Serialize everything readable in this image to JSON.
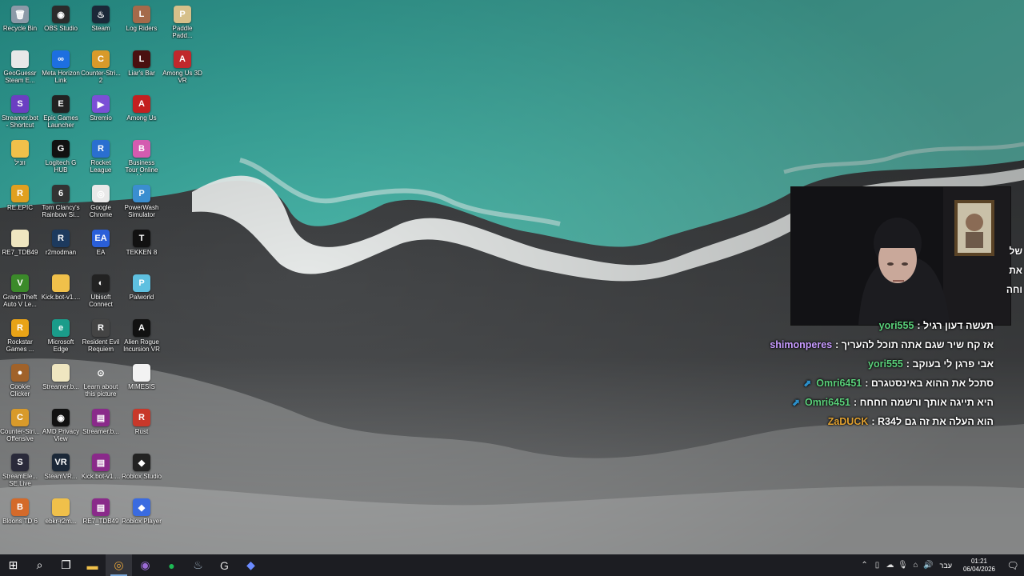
{
  "desktop": {
    "icons": [
      {
        "label": "Recycle Bin",
        "icon": "recycle-bin-icon",
        "bg": "#8c9aa8",
        "glyph": "🗑"
      },
      {
        "label": "OBS Studio",
        "icon": "obs-icon",
        "bg": "#2b2b2b",
        "glyph": "◉"
      },
      {
        "label": "Steam",
        "icon": "steam-icon",
        "bg": "#1b2838",
        "glyph": "♨"
      },
      {
        "label": "Log Riders",
        "icon": "log-riders-icon",
        "bg": "#a56a4a",
        "glyph": "L"
      },
      {
        "label": "Paddle Padd...",
        "icon": "paddle-icon",
        "bg": "#d6c08a",
        "glyph": "P"
      },
      {
        "label": "GeoGuessr Steam E...",
        "icon": "file-icon",
        "bg": "#e8e8e8",
        "glyph": ""
      },
      {
        "label": "Meta Horizon Link",
        "icon": "meta-icon",
        "bg": "#1d6fe0",
        "glyph": "∞"
      },
      {
        "label": "Counter-Stri... 2",
        "icon": "cs2-icon",
        "bg": "#d89a2a",
        "glyph": "C"
      },
      {
        "label": "Liar's Bar",
        "icon": "liars-bar-icon",
        "bg": "#4a1010",
        "glyph": "L"
      },
      {
        "label": "Among Us 3D VR",
        "icon": "among-us-vr-icon",
        "bg": "#c0282c",
        "glyph": "A"
      },
      {
        "label": "Streamer.bot - Shortcut",
        "icon": "streamerbot-icon",
        "bg": "#6b3fc2",
        "glyph": "S"
      },
      {
        "label": "Epic Games Launcher",
        "icon": "epic-icon",
        "bg": "#222",
        "glyph": "E"
      },
      {
        "label": "Stremio",
        "icon": "stremio-icon",
        "bg": "#7b4fd6",
        "glyph": "▶"
      },
      {
        "label": "Among Us",
        "icon": "among-us-icon",
        "bg": "#c32020",
        "glyph": "A"
      },
      {
        "label": "",
        "icon": "empty-slot",
        "bg": "transparent",
        "glyph": ""
      },
      {
        "label": "ווניל",
        "icon": "folder-icon",
        "bg": "#f0c04a",
        "glyph": ""
      },
      {
        "label": "Logitech G HUB",
        "icon": "logitech-icon",
        "bg": "#111",
        "glyph": "G"
      },
      {
        "label": "Rocket League",
        "icon": "rocket-league-icon",
        "bg": "#2a6fd0",
        "glyph": "R"
      },
      {
        "label": "Business Tour Online M...",
        "icon": "business-tour-icon",
        "bg": "#d45bb0",
        "glyph": "B"
      },
      {
        "label": "",
        "icon": "empty-slot",
        "bg": "transparent",
        "glyph": ""
      },
      {
        "label": "RE.EPIC",
        "icon": "re-epic-icon",
        "bg": "#e0a020",
        "glyph": "R"
      },
      {
        "label": "Tom Clancy's Rainbow Si...",
        "icon": "rainbow-six-icon",
        "bg": "#333",
        "glyph": "6"
      },
      {
        "label": "Google Chrome",
        "icon": "chrome-icon",
        "bg": "#e9e9e9",
        "glyph": "◎"
      },
      {
        "label": "PowerWash Simulator",
        "icon": "powerwash-icon",
        "bg": "#3a8ed0",
        "glyph": "P"
      },
      {
        "label": "",
        "icon": "empty-slot",
        "bg": "transparent",
        "glyph": ""
      },
      {
        "label": "RE7_TDB49",
        "icon": "file-icon",
        "bg": "#efe6c0",
        "glyph": ""
      },
      {
        "label": "r2modman",
        "icon": "r2modman-icon",
        "bg": "#1d3a5e",
        "glyph": "R"
      },
      {
        "label": "EA",
        "icon": "ea-icon",
        "bg": "#2a5fd8",
        "glyph": "EA"
      },
      {
        "label": "TEKKEN 8",
        "icon": "tekken-icon",
        "bg": "#111",
        "glyph": "T"
      },
      {
        "label": "",
        "icon": "empty-slot",
        "bg": "transparent",
        "glyph": ""
      },
      {
        "label": "Grand Theft Auto V Le...",
        "icon": "gta-icon",
        "bg": "#3b8a2a",
        "glyph": "V"
      },
      {
        "label": "Kick.bot-v1....",
        "icon": "folder-icon",
        "bg": "#f0c04a",
        "glyph": ""
      },
      {
        "label": "Ubisoft Connect",
        "icon": "ubisoft-icon",
        "bg": "#222",
        "glyph": "◐"
      },
      {
        "label": "Palworld",
        "icon": "palworld-icon",
        "bg": "#5ec0e0",
        "glyph": "P"
      },
      {
        "label": "",
        "icon": "empty-slot",
        "bg": "transparent",
        "glyph": ""
      },
      {
        "label": "Rockstar Games ...",
        "icon": "rockstar-icon",
        "bg": "#e8a317",
        "glyph": "R"
      },
      {
        "label": "Microsoft Edge",
        "icon": "edge-icon",
        "bg": "#1a9c8a",
        "glyph": "e"
      },
      {
        "label": "Resident Evil Requiem",
        "icon": "resident-evil-icon",
        "bg": "#444",
        "glyph": "R"
      },
      {
        "label": "Alien Rogue Incursion VR",
        "icon": "alien-icon",
        "bg": "#111",
        "glyph": "A"
      },
      {
        "label": "",
        "icon": "empty-slot",
        "bg": "transparent",
        "glyph": ""
      },
      {
        "label": "Cookie Clicker",
        "icon": "cookie-icon",
        "bg": "#a0622a",
        "glyph": "●"
      },
      {
        "label": "Streamer.b...",
        "icon": "file-icon",
        "bg": "#efe6c0",
        "glyph": ""
      },
      {
        "label": "Learn about this picture",
        "icon": "camera-icon",
        "bg": "transparent",
        "glyph": "⊙"
      },
      {
        "label": "MIMESIS",
        "icon": "file-icon",
        "bg": "#f2f2f2",
        "glyph": ""
      },
      {
        "label": "",
        "icon": "empty-slot",
        "bg": "transparent",
        "glyph": ""
      },
      {
        "label": "Counter-Stri... Offensive",
        "icon": "csgo-icon",
        "bg": "#d89a2a",
        "glyph": "C"
      },
      {
        "label": "AMD Privacy View",
        "icon": "amd-icon",
        "bg": "#111",
        "glyph": "◉"
      },
      {
        "label": "Streamer.b...",
        "icon": "winrar-icon",
        "bg": "#8a2a8a",
        "glyph": "▤"
      },
      {
        "label": "Rust",
        "icon": "rust-icon",
        "bg": "#c8382a",
        "glyph": "R"
      },
      {
        "label": "",
        "icon": "empty-slot",
        "bg": "transparent",
        "glyph": ""
      },
      {
        "label": "StreamEle... SE.Live",
        "icon": "streamelements-icon",
        "bg": "#2a2a3a",
        "glyph": "S"
      },
      {
        "label": "SteamVR...",
        "icon": "steamvr-icon",
        "bg": "#1b2838",
        "glyph": "VR"
      },
      {
        "label": "Kick.bot-v1....",
        "icon": "winrar-icon",
        "bg": "#8a2a8a",
        "glyph": "▤"
      },
      {
        "label": "Roblox Studio",
        "icon": "roblox-studio-icon",
        "bg": "#222",
        "glyph": "◆"
      },
      {
        "label": "",
        "icon": "empty-slot",
        "bg": "transparent",
        "glyph": ""
      },
      {
        "label": "Bloons TD 6",
        "icon": "bloons-icon",
        "bg": "#d46a2a",
        "glyph": "B"
      },
      {
        "label": "ebkr-r2m...",
        "icon": "folder-icon",
        "bg": "#f0c04a",
        "glyph": ""
      },
      {
        "label": "RE7_TDB49",
        "icon": "winrar-icon",
        "bg": "#8a2a8a",
        "glyph": "▤"
      },
      {
        "label": "Roblox Player",
        "icon": "roblox-icon",
        "bg": "#3a6be0",
        "glyph": "◆"
      },
      {
        "label": "",
        "icon": "empty-slot",
        "bg": "transparent",
        "glyph": ""
      }
    ]
  },
  "chat": {
    "edge_fragments": [
      {
        "text": "של"
      },
      {
        "text": "את"
      },
      {
        "text": "וחה"
      }
    ],
    "messages": [
      {
        "user": "yori555",
        "user_color": "#5ad07a",
        "badge": "",
        "text": ": תעשה דעון רגיל"
      },
      {
        "user": "shimonperes",
        "user_color": "#c79bff",
        "badge": "",
        "text": ": אז קח שיר שגם אתה תוכל להעריך"
      },
      {
        "user": "yori555",
        "user_color": "#5ad07a",
        "badge": "",
        "text": ": אבי פרגן לי בעוקב"
      },
      {
        "user": "Omri6451",
        "user_color": "#5ad07a",
        "badge": "⬈",
        "text": ": סתכל את ההוא באינסטגרם"
      },
      {
        "user": "Omri6451",
        "user_color": "#5ad07a",
        "badge": "⬈",
        "text": ": היא תייגה אותך ורשמה חחחח"
      },
      {
        "user": "ZaDUCK",
        "user_color": "#e0a030",
        "badge": "",
        "text": ": R34הוא העלה את זה גם ל"
      }
    ]
  },
  "taskbar": {
    "apps": [
      {
        "name": "start-button",
        "glyph": "⊞",
        "active": false
      },
      {
        "name": "search-button",
        "glyph": "⌕",
        "active": false
      },
      {
        "name": "task-view-button",
        "glyph": "❐",
        "active": false
      },
      {
        "name": "file-explorer-button",
        "glyph": "▬",
        "active": false,
        "color": "#f0c04a"
      },
      {
        "name": "chrome-taskbar-button",
        "glyph": "◎",
        "active": true,
        "color": "#e5a43a"
      },
      {
        "name": "obs-taskbar-button",
        "glyph": "◉",
        "active": false,
        "color": "#9b6bd6"
      },
      {
        "name": "spotify-taskbar-button",
        "glyph": "●",
        "active": false,
        "color": "#1db954"
      },
      {
        "name": "steam-taskbar-button",
        "glyph": "♨",
        "active": false,
        "color": "#9ab"
      },
      {
        "name": "logitech-taskbar-button",
        "glyph": "G",
        "active": false,
        "color": "#ddd"
      },
      {
        "name": "streamerbot-taskbar-button",
        "glyph": "◆",
        "active": false,
        "color": "#6b8bff"
      }
    ],
    "tray": {
      "language": "עבר",
      "time": "01:21",
      "date": "06/04/2026"
    }
  }
}
